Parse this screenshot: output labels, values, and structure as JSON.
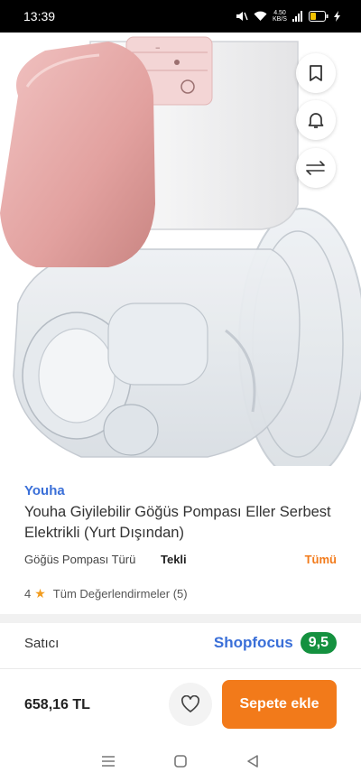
{
  "status": {
    "time": "13:39",
    "network": "4.50 KB/S",
    "icons": [
      "mute-icon",
      "wifi-icon",
      "signal-icon",
      "battery-icon",
      "charging-icon"
    ]
  },
  "hero": {
    "image_description_icon": "breast-pump-product-image",
    "buttons": [
      "bookmark-icon",
      "bell-icon",
      "compare-arrows-icon"
    ]
  },
  "product": {
    "brand": "Youha",
    "title": "Youha Giyilebilir Göğüs Pompası Eller Serbest Elektrikli (Yurt Dışından)",
    "variant_label": "Göğüs Pompası Türü",
    "variant_value": "Tekli",
    "variant_all": "Tümü",
    "rating": "4",
    "reviews_text": "Tüm Değerlendirmeler (5)"
  },
  "seller": {
    "label": "Satıcı",
    "name": "Shopfocus",
    "score": "9,5"
  },
  "purchase": {
    "price": "658,16 TL",
    "add_to_cart": "Sepete ekle"
  },
  "colors": {
    "brand_blue": "#3a6fd8",
    "accent_orange": "#f27a1a",
    "score_green": "#14913f",
    "pump_pink": "#e8a9a8"
  }
}
